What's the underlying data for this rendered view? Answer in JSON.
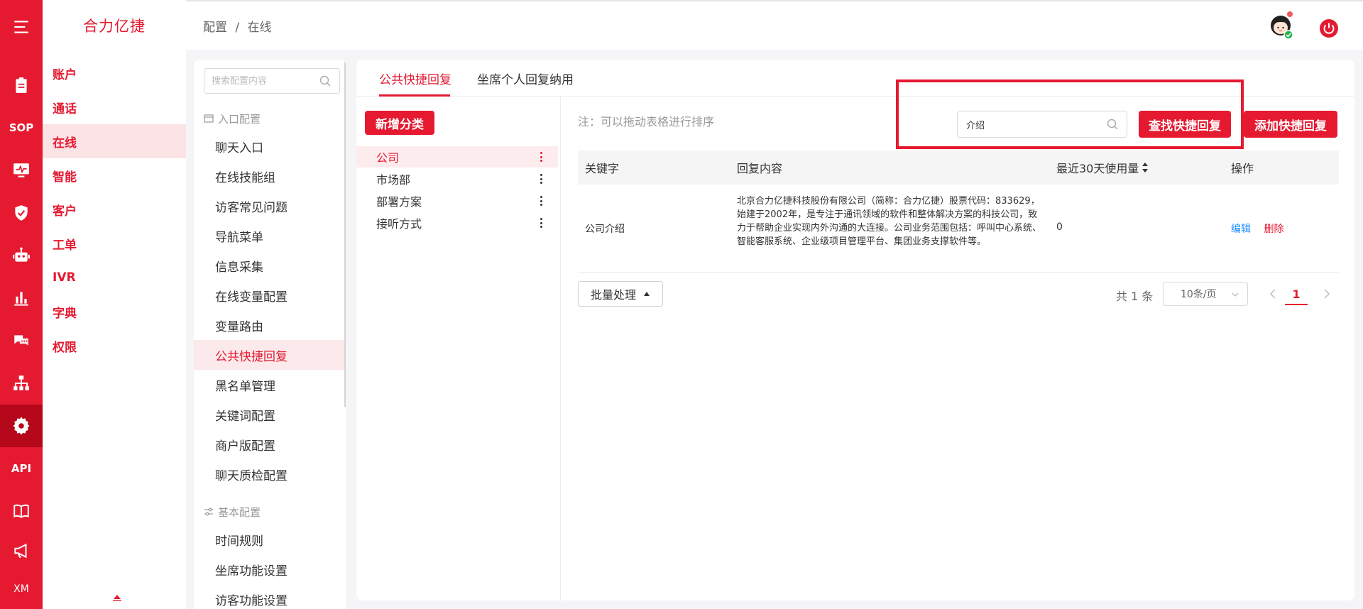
{
  "app": {
    "brand": "合力亿捷",
    "accent_color": "#e51a31"
  },
  "rail": {
    "items": [
      {
        "icon": "menu-icon"
      },
      {
        "icon": "clipboard-icon"
      },
      {
        "text": "SOP"
      },
      {
        "icon": "monitor-icon"
      },
      {
        "icon": "shield-icon"
      },
      {
        "icon": "robot-icon"
      },
      {
        "icon": "bar-chart-icon"
      },
      {
        "icon": "chat-icon"
      },
      {
        "icon": "org-chart-icon"
      },
      {
        "icon": "gear-icon",
        "active": true
      },
      {
        "text": "API"
      },
      {
        "icon": "book-icon"
      },
      {
        "icon": "megaphone-icon"
      },
      {
        "text": "XM"
      }
    ]
  },
  "nav": {
    "items": [
      {
        "label": "账户"
      },
      {
        "label": "通话"
      },
      {
        "label": "在线",
        "active": true
      },
      {
        "label": "智能"
      },
      {
        "label": "客户"
      },
      {
        "label": "工单"
      },
      {
        "label": "IVR"
      },
      {
        "label": "字典"
      },
      {
        "label": "权限"
      }
    ]
  },
  "header": {
    "breadcrumb": [
      "配置",
      "/",
      "在线"
    ]
  },
  "config_menu": {
    "search_placeholder": "搜索配置内容",
    "groups": [
      {
        "title": "入口配置",
        "items": [
          "聊天入口",
          "在线技能组",
          "访客常见问题",
          "导航菜单",
          "信息采集",
          "在线变量配置",
          "变量路由",
          "公共快捷回复",
          "黑名单管理",
          "关键词配置",
          "商户版配置",
          "聊天质检配置"
        ]
      },
      {
        "title": "基本配置",
        "items": [
          "时间规则",
          "坐席功能设置",
          "访客功能设置"
        ]
      }
    ],
    "active_item": "公共快捷回复"
  },
  "main": {
    "tabs": [
      {
        "label": "公共快捷回复",
        "active": true
      },
      {
        "label": "坐席个人回复纳用"
      }
    ],
    "add_category_label": "新增分类",
    "categories": [
      {
        "label": "公司",
        "active": true
      },
      {
        "label": "市场部"
      },
      {
        "label": "部署方案"
      },
      {
        "label": "接听方式"
      }
    ],
    "note": "注：可以拖动表格进行排序",
    "search_value": "介绍",
    "find_button": "查找快捷回复",
    "add_button": "添加快捷回复",
    "table": {
      "headers": [
        "关键字",
        "回复内容",
        "最近30天使用量",
        "操作"
      ],
      "rows": [
        {
          "keyword": "公司介绍",
          "content": "北京合力亿捷科技股份有限公司（简称：合力亿捷）股票代码：833629，始建于2002年，是专注于通讯领域的软件和整体解决方案的科技公司，致力于帮助企业实现内外沟通的大连接。公司业务范围包括：呼叫中心系统、智能客服系统、企业级项目管理平台、集团业务支撑软件等。",
          "usage": "0",
          "edit": "编辑",
          "delete": "删除"
        }
      ]
    },
    "batch_label": "批量处理",
    "total": "共 1 条",
    "page_size": "10条/页",
    "current_page": "1"
  }
}
